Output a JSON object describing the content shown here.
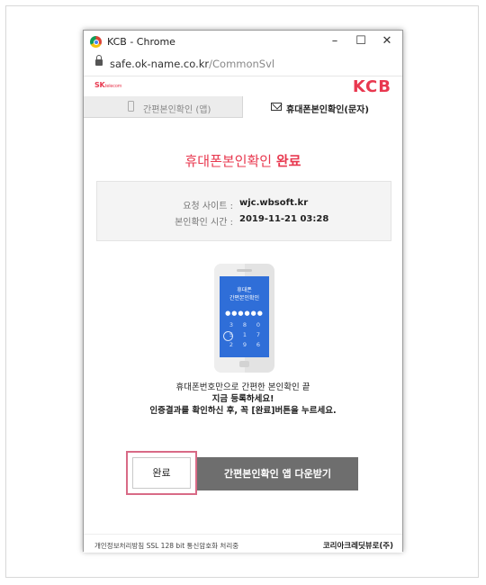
{
  "window": {
    "title": "KCB - Chrome",
    "controls": {
      "minimize": "–",
      "maximize": "☐",
      "close": "✕"
    }
  },
  "address_bar": {
    "url_host": "safe.ok-name.co.kr",
    "url_path": "/CommonSvl"
  },
  "header": {
    "sk_logo": "SK",
    "sk_logo_sub": "telecom",
    "kcb_logo": "KCB"
  },
  "tabs": [
    {
      "label": "간편본인확인 (앱)",
      "icon": "phone-icon",
      "active": false
    },
    {
      "label": "휴대폰본인확인(문자)",
      "icon": "mail-icon",
      "active": true
    }
  ],
  "main": {
    "title_normal": "휴대폰본인확인 ",
    "title_bold": "완료",
    "info": {
      "request_site_label": "요청 사이트 :",
      "request_site_value": "wjc.wbsoft.kr",
      "verify_time_label": "본인확인 시간 :",
      "verify_time_value": "2019-11-21 03:28"
    },
    "phone_illustration": {
      "line1": "휴대폰",
      "line2": "간편본인확인",
      "dots": "●●●●●●",
      "keys": [
        "3",
        "8",
        "0",
        "5",
        "1",
        "7",
        "2",
        "9",
        "6"
      ]
    },
    "description": {
      "line1": "휴대폰번호만으로 간편한 본인확인 끝",
      "line2": "지금 등록하세요!",
      "line3": "인증결과를 확인하신 후, 꼭 [완료]버튼을 누르세요."
    },
    "buttons": {
      "done": "완료",
      "download_app": "간편본인확인 앱 다운받기"
    }
  },
  "footer": {
    "left": "개인정보처리방침   SSL 128 bit 통신암호화 처리중",
    "right": "코리아크레딧뷰로(주)"
  },
  "colors": {
    "accent": "#e8384f",
    "highlight_box": "#d86a86",
    "phone_screen": "#2f6ed8",
    "download_button": "#6e6e6e"
  }
}
